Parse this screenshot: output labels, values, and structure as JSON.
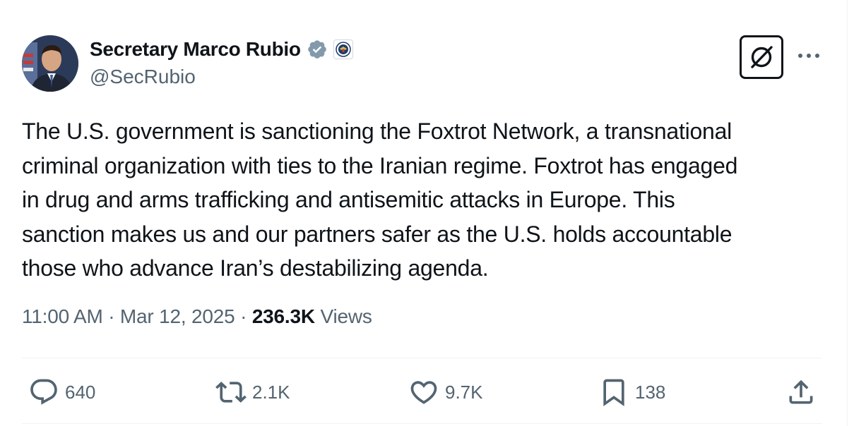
{
  "author": {
    "name": "Secretary Marco Rubio",
    "handle": "@SecRubio",
    "verified_icon": "verified-badge-icon",
    "affiliation_icon": "state-department-seal-icon"
  },
  "header_actions": {
    "grok_icon": "grok-icon",
    "more_icon": "more-icon"
  },
  "tweet": {
    "text": "The U.S. government is sanctioning the Foxtrot Network, a transnational\ncriminal organization with ties to the Iranian regime. Foxtrot has engaged\nin drug and arms trafficking and antisemitic attacks in Europe. This\nsanction makes us and our partners safer as the U.S. holds accountable\nthose who advance Iran’s destabilizing agenda.",
    "time": "11:00 AM",
    "date": "Mar 12, 2025",
    "separator": " · ",
    "views_count": "236.3K",
    "views_label": " Views"
  },
  "actions": {
    "reply_count": "640",
    "repost_count": "2.1K",
    "like_count": "9.7K",
    "bookmark_count": "138"
  },
  "colors": {
    "text_primary": "#0f1419",
    "text_secondary": "#536471",
    "verified": "#829aab",
    "divider": "#eff3f4"
  }
}
